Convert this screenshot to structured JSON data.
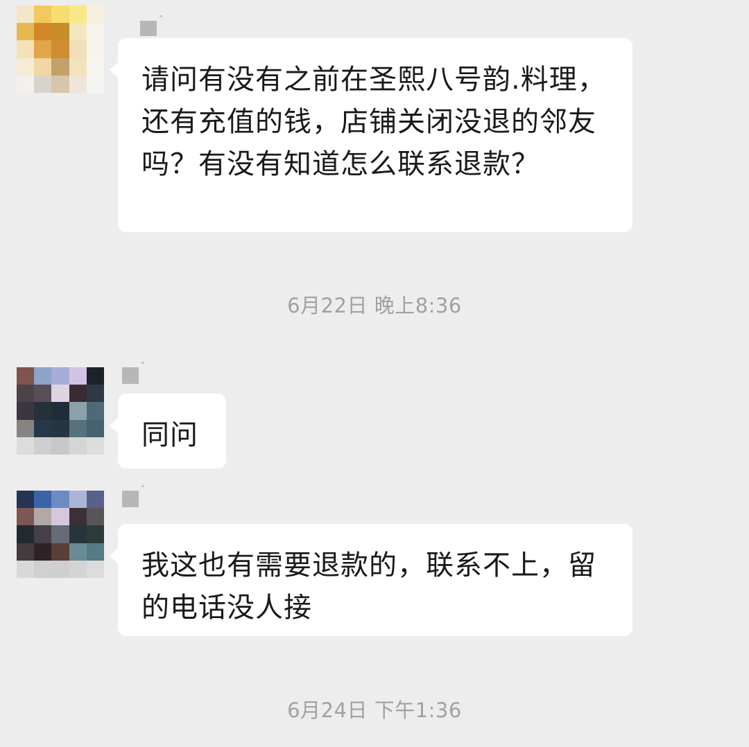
{
  "messages": [
    {
      "text": "请问有没有之前在圣熙八号韵.料理，还有充值的钱，店铺关闭没退的邻友吗？有没有知道怎么联系退款？"
    },
    {
      "text": "同问"
    },
    {
      "text": "我这也有需要退款的，联系不上，留的电话没人接"
    }
  ],
  "timestamps": [
    {
      "text": "6月22日 晚上8:36"
    },
    {
      "text": "6月24日 下午1:36"
    }
  ],
  "avatars": [
    {
      "name": "pixelated-avatar-1",
      "colors": [
        "#f3e7c9",
        "#f1c95c",
        "#f7dd6f",
        "#f9e886",
        "#f7f0e1",
        "#e7b84f",
        "#d3872a",
        "#c78d2b",
        "#f3e7c0",
        "#f8f3ea",
        "#f3e2b7",
        "#e1a54a",
        "#cf8c30",
        "#f1dfb8",
        "#f8f3ec",
        "#f6ecd5",
        "#f0d7a3",
        "#c2a16b",
        "#f2e3bf",
        "#f7f5ef",
        "#f4f1ec",
        "#d8d4cc",
        "#d7c6aa",
        "#efe6d7",
        "#f6f4f1"
      ]
    },
    {
      "name": "pixelated-avatar-2",
      "colors": [
        "#80534f",
        "#8ea3c8",
        "#a8acd8",
        "#d2c3e4",
        "#1d2129",
        "#4b4346",
        "#584e55",
        "#dfd3e2",
        "#3b2a33",
        "#2f3943",
        "#3b3641",
        "#263038",
        "#1f2d3b",
        "#8ba2ad",
        "#4d6a76",
        "#878381",
        "#24384a",
        "#263540",
        "#56727e",
        "#466170",
        "#dcdcdc",
        "#cfcfcf",
        "#c8c8c8",
        "#d5d5d5",
        "#dddddd"
      ]
    },
    {
      "name": "pixelated-avatar-3",
      "colors": [
        "#243452",
        "#3b63a7",
        "#6e8ac2",
        "#aab5d7",
        "#59618b",
        "#7e5656",
        "#b2a8a7",
        "#d6c7df",
        "#3a3036",
        "#585457",
        "#222a31",
        "#454048",
        "#666c76",
        "#28343b",
        "#2d3a3a",
        "#443b40",
        "#2f2227",
        "#5a3f39",
        "#6a8a97",
        "#567a86",
        "#d8d8d8",
        "#d0d0d0",
        "#cfcfcf",
        "#d4d4d4",
        "#dcdcdc"
      ]
    }
  ]
}
